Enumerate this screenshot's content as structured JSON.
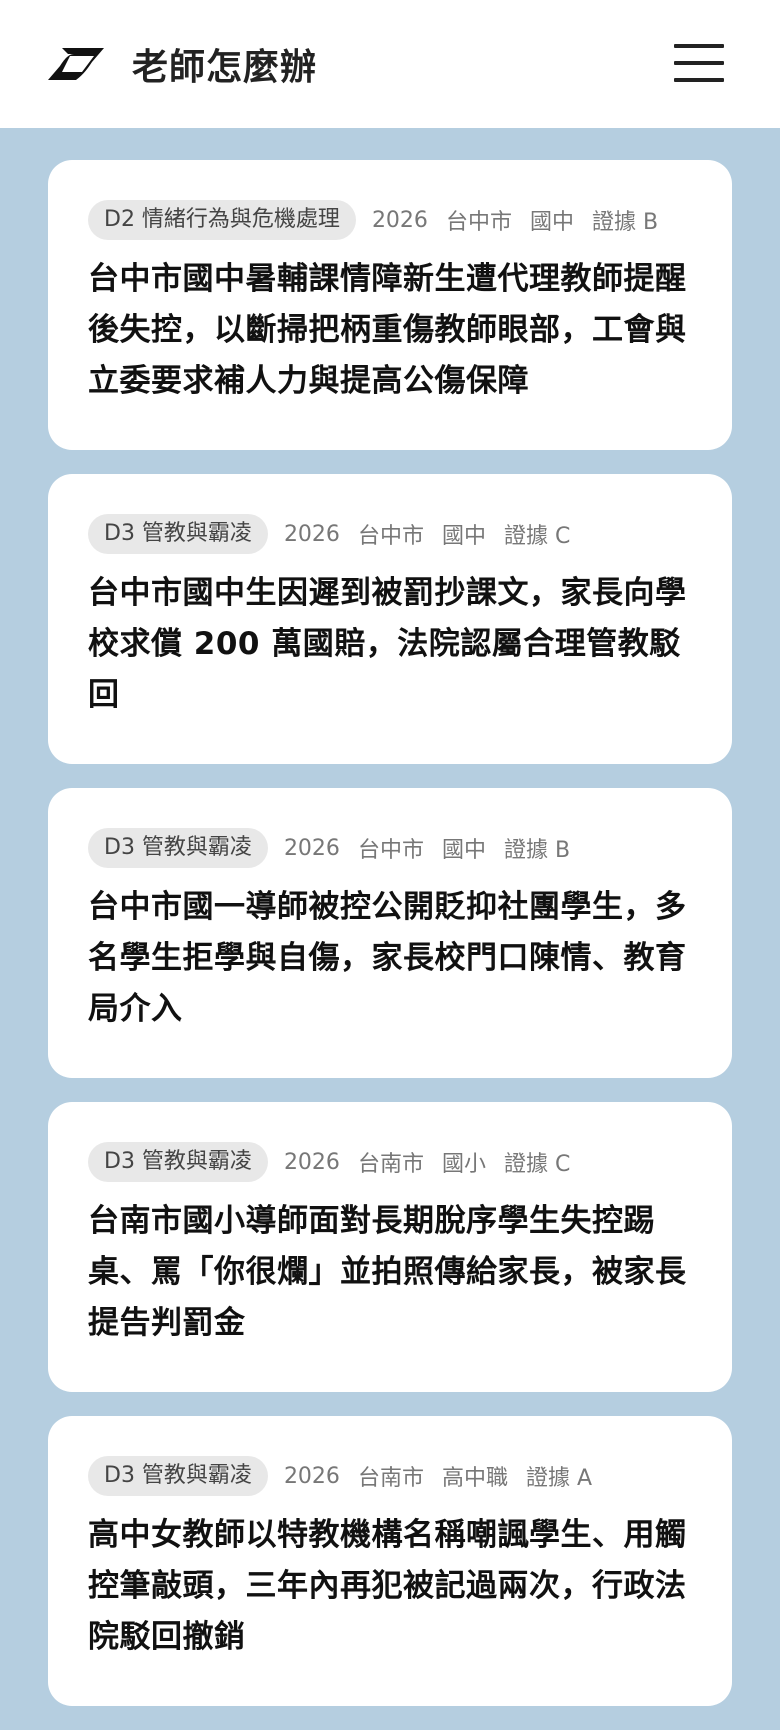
{
  "header": {
    "site_title": "老師怎麼辦"
  },
  "cases": [
    {
      "category": "D2 情緒行為與危機處理",
      "year": "2026",
      "city": "台中市",
      "level": "國中",
      "evidence": "證據 B",
      "title": "台中市國中暑輔課情障新生遭代理教師提醒後失控，以斷掃把柄重傷教師眼部，工會與立委要求補人力與提高公傷保障"
    },
    {
      "category": "D3 管教與霸凌",
      "year": "2026",
      "city": "台中市",
      "level": "國中",
      "evidence": "證據 C",
      "title": "台中市國中生因遲到被罰抄課文，家長向學校求償 200 萬國賠，法院認屬合理管教駁回"
    },
    {
      "category": "D3 管教與霸凌",
      "year": "2026",
      "city": "台中市",
      "level": "國中",
      "evidence": "證據 B",
      "title": "台中市國一導師被控公開貶抑社團學生，多名學生拒學與自傷，家長校門口陳情、教育局介入"
    },
    {
      "category": "D3 管教與霸凌",
      "year": "2026",
      "city": "台南市",
      "level": "國小",
      "evidence": "證據 C",
      "title": "台南市國小導師面對長期脫序學生失控踢桌、罵「你很爛」並拍照傳給家長，被家長提告判罰金"
    },
    {
      "category": "D3 管教與霸凌",
      "year": "2026",
      "city": "台南市",
      "level": "高中職",
      "evidence": "證據 A",
      "title": "高中女教師以特教機構名稱嘲諷學生、用觸控筆敲頭，三年內再犯被記過兩次，行政法院駁回撤銷"
    }
  ]
}
